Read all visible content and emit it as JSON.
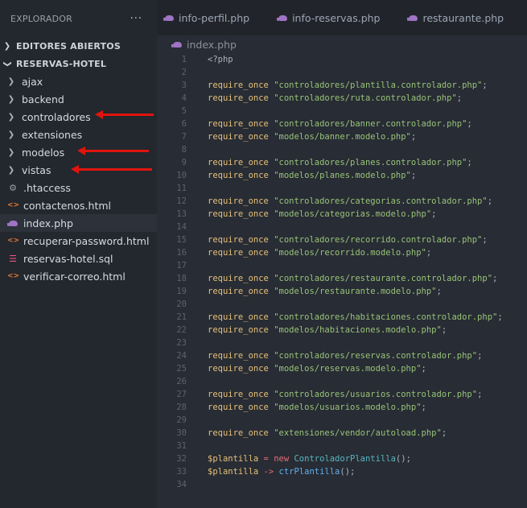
{
  "explorer": {
    "title": "EXPLORADOR",
    "more": "···",
    "open_editors": "EDITORES ABIERTOS",
    "project": "RESERVAS-HOTEL",
    "items": [
      {
        "label": "ajax",
        "type": "folder"
      },
      {
        "label": "backend",
        "type": "folder"
      },
      {
        "label": "controladores",
        "type": "folder"
      },
      {
        "label": "extensiones",
        "type": "folder"
      },
      {
        "label": "modelos",
        "type": "folder"
      },
      {
        "label": "vistas",
        "type": "folder"
      },
      {
        "label": ".htaccess",
        "type": "gear",
        "color": "#9aa0a8"
      },
      {
        "label": "contactenos.html",
        "type": "html",
        "color": "#e37933"
      },
      {
        "label": "index.php",
        "type": "php",
        "color": "#a074c4"
      },
      {
        "label": "recuperar-password.html",
        "type": "html",
        "color": "#e37933"
      },
      {
        "label": "reservas-hotel.sql",
        "type": "sql",
        "color": "#f55385"
      },
      {
        "label": "verificar-correo.html",
        "type": "html",
        "color": "#e37933"
      }
    ]
  },
  "tabs": [
    "info-perfil.php",
    "info-reservas.php",
    "restaurante.php"
  ],
  "breadcrumb": "index.php",
  "code": {
    "require": "require_once",
    "php_open": "<?php",
    "requires": [
      {
        "line": 3,
        "path": "\"controladores/plantilla.controlador.php\""
      },
      {
        "line": 4,
        "path": "\"controladores/ruta.controlador.php\""
      },
      {
        "line": 6,
        "path": "\"controladores/banner.controlador.php\""
      },
      {
        "line": 7,
        "path": "\"modelos/banner.modelo.php\""
      },
      {
        "line": 9,
        "path": "\"controladores/planes.controlador.php\""
      },
      {
        "line": 10,
        "path": "\"modelos/planes.modelo.php\""
      },
      {
        "line": 12,
        "path": "\"controladores/categorias.controlador.php\""
      },
      {
        "line": 13,
        "path": "\"modelos/categorias.modelo.php\""
      },
      {
        "line": 15,
        "path": "\"controladores/recorrido.controlador.php\""
      },
      {
        "line": 16,
        "path": "\"modelos/recorrido.modelo.php\""
      },
      {
        "line": 18,
        "path": "\"controladores/restaurante.controlador.php\""
      },
      {
        "line": 19,
        "path": "\"modelos/restaurante.modelo.php\""
      },
      {
        "line": 21,
        "path": "\"controladores/habitaciones.controlador.php\""
      },
      {
        "line": 22,
        "path": "\"modelos/habitaciones.modelo.php\""
      },
      {
        "line": 24,
        "path": "\"controladores/reservas.controlador.php\""
      },
      {
        "line": 25,
        "path": "\"modelos/reservas.modelo.php\""
      },
      {
        "line": 27,
        "path": "\"controladores/usuarios.controlador.php\""
      },
      {
        "line": 28,
        "path": "\"modelos/usuarios.modelo.php\""
      },
      {
        "line": 30,
        "path": "\"extensiones/vendor/autoload.php\""
      }
    ],
    "line32": {
      "var": "$plantilla",
      "eq": " = ",
      "kw": "new ",
      "cls": "ControladorPlantilla",
      "end": "();"
    },
    "line33": {
      "var": "$plantilla",
      "arrow": " -> ",
      "fn": "ctrPlantilla",
      "end": "();"
    },
    "semicolon": ";",
    "total_lines": 34
  },
  "colors": {
    "annotation_arrow": "#e0140e"
  }
}
